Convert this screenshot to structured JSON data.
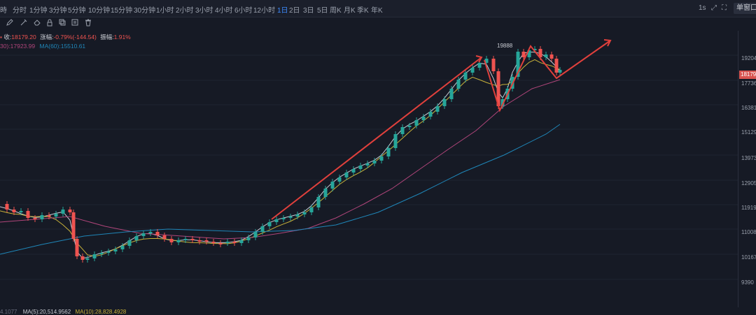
{
  "toolbar": {
    "timeframes": [
      "時",
      "分时",
      "1分钟",
      "3分钟",
      "5分钟",
      "10分钟",
      "15分钟",
      "30分钟",
      "1小时",
      "2小时",
      "3小时",
      "4小时",
      "6小时",
      "12小时",
      "1日",
      "2日",
      "3日",
      "5日",
      "周K",
      "月K",
      "季K",
      "年K"
    ],
    "active_timeframe": "1日",
    "right_label": "1s",
    "single_window_label": "单窗口"
  },
  "ohlc": {
    "close_label": "收:",
    "close_value": "18179.20",
    "change_label": "涨幅:",
    "change_value": "-0.79%(-144.54)",
    "amplitude_label": "振幅:",
    "amplitude_value": "1.91%"
  },
  "ma_line": {
    "ma30_text": "30):17923.99",
    "ma60_text": "MA(60):15510.61"
  },
  "y_axis": {
    "ticks": [
      "19204",
      "17736",
      "16381",
      "15129",
      "13973",
      "12905",
      "11919",
      "11008",
      "10167",
      "9390"
    ],
    "current_price_tag": "18179"
  },
  "annotation": {
    "high_label": "19888"
  },
  "volume": {
    "left_text": "4.1077",
    "ma5_text": "MA(5):20,514.9562",
    "ma10_text": "MA(10):28,828.4928"
  },
  "colors": {
    "up": "#26a69a",
    "down": "#ef5350",
    "ma5": "#c7cbd3",
    "ma10": "#c9b23a",
    "ma30": "#b0457a",
    "ma60": "#1f86b8",
    "accent": "#3d8bfd",
    "arrow": "#e0403c"
  }
}
